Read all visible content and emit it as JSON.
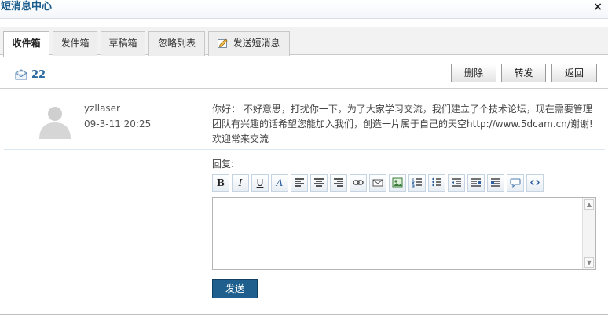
{
  "window": {
    "title": "短消息中心",
    "close_label": "×"
  },
  "tabs": [
    {
      "label": "收件箱",
      "active": true
    },
    {
      "label": "发件箱"
    },
    {
      "label": "草稿箱"
    },
    {
      "label": "忽略列表"
    },
    {
      "label": "发送短消息",
      "icon": "pencil-icon"
    }
  ],
  "inbox": {
    "count": "22",
    "icon": "mail-icon"
  },
  "actions": {
    "delete": "删除",
    "forward": "转发",
    "back": "返回"
  },
  "message": {
    "sender": "yzllaser",
    "time": "09-3-11 20:25",
    "lines": [
      "你好： 不好意思，打扰你一下，为了大家学习交流，我们建立了个技术论坛，现在需要管理",
      "团队有兴趣的话希望您能加入我们，创造一片属于自己的天空http://www.5dcam.cn/谢谢!",
      "欢迎常来交流"
    ]
  },
  "reply": {
    "label": "回复:",
    "editor_value": "",
    "send_label": "发送",
    "toolbar": [
      {
        "name": "bold-icon",
        "glyph": "B"
      },
      {
        "name": "italic-icon",
        "glyph": "I"
      },
      {
        "name": "underline-icon",
        "glyph": "U"
      },
      {
        "name": "font-color-icon",
        "glyph": "A"
      },
      {
        "name": "align-left-icon"
      },
      {
        "name": "align-center-icon"
      },
      {
        "name": "align-right-icon"
      },
      {
        "name": "link-icon"
      },
      {
        "name": "email-icon"
      },
      {
        "name": "image-icon"
      },
      {
        "name": "ordered-list-icon"
      },
      {
        "name": "unordered-list-icon"
      },
      {
        "name": "outdent-icon"
      },
      {
        "name": "indent-icon"
      },
      {
        "name": "quote-icon"
      },
      {
        "name": "smiley-icon"
      },
      {
        "name": "code-icon"
      }
    ]
  },
  "colors": {
    "accent": "#1e5f8e",
    "title": "#1a5c8c",
    "count": "#2b6aa0"
  }
}
